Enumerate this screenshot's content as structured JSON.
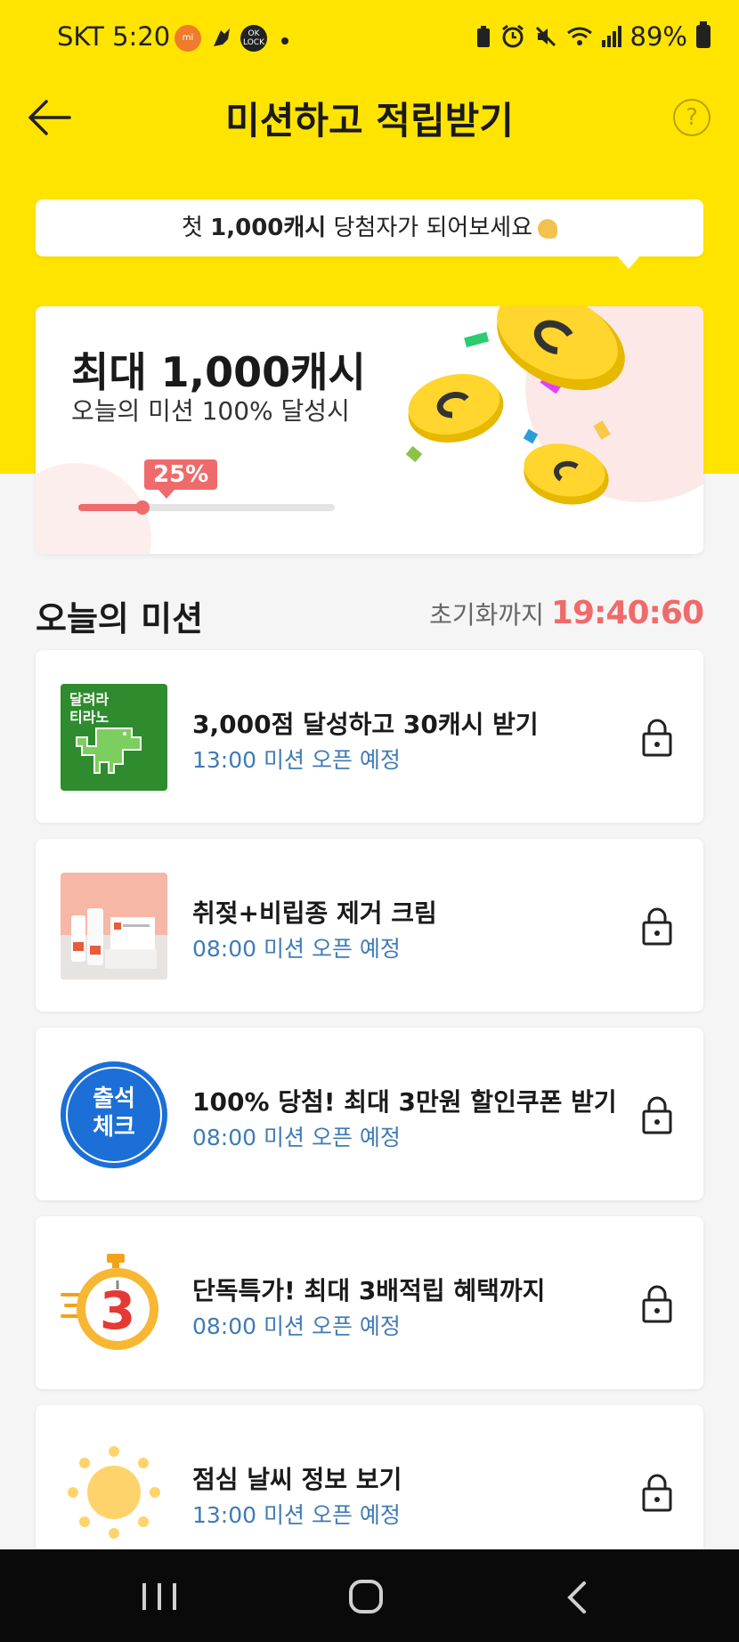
{
  "status_bar": {
    "carrier_time": "SKT 5:20",
    "battery": "89%"
  },
  "header": {
    "title": "미션하고 적립받기",
    "help_label": "?"
  },
  "banner": {
    "prefix": "첫 ",
    "amount": "1,000캐시",
    "suffix": " 당첨자가 되어보세요"
  },
  "reward_card": {
    "headline": "최대 1,000캐시",
    "subtext": "오늘의 미션 100% 달성시",
    "progress_label": "25%",
    "progress_fraction": 0.25
  },
  "missions_section": {
    "title": "오늘의 미션",
    "reset_label": "초기화까지",
    "reset_time": "19:40:60"
  },
  "missions": [
    {
      "title": "3,000점 달성하고 30캐시 받기",
      "open_time": "13:00 미션 오픈 예정",
      "icon": "dino-game-thumbnail",
      "thumb_text1": "달려라",
      "thumb_text2": "티라노"
    },
    {
      "title": "취젖+비립종 제거 크림",
      "open_time": "08:00 미션 오픈 예정",
      "icon": "cream-product-thumbnail"
    },
    {
      "title": "100% 당첨! 최대 3만원 할인쿠폰 받기",
      "open_time": "08:00 미션 오픈 예정",
      "icon": "attendance-check-icon",
      "thumb_text1": "출석",
      "thumb_text2": "체크"
    },
    {
      "title": "단독특가! 최대 3배적립 혜택까지",
      "open_time": "08:00 미션 오픈 예정",
      "icon": "stopwatch-3-icon",
      "thumb_text1": "3"
    },
    {
      "title": "점심 날씨 정보 보기",
      "open_time": "13:00 미션 오픈 예정",
      "icon": "sun-icon"
    }
  ],
  "colors": {
    "brand_yellow": "#ffe400",
    "accent_red": "#ef6b6b",
    "open_time_blue": "#3f7bb5"
  }
}
